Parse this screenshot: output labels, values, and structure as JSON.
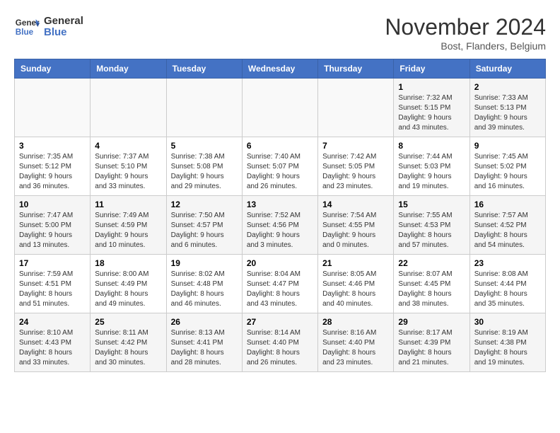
{
  "header": {
    "logo_line1": "General",
    "logo_line2": "Blue",
    "month_title": "November 2024",
    "subtitle": "Bost, Flanders, Belgium"
  },
  "weekdays": [
    "Sunday",
    "Monday",
    "Tuesday",
    "Wednesday",
    "Thursday",
    "Friday",
    "Saturday"
  ],
  "weeks": [
    [
      {
        "day": "",
        "info": ""
      },
      {
        "day": "",
        "info": ""
      },
      {
        "day": "",
        "info": ""
      },
      {
        "day": "",
        "info": ""
      },
      {
        "day": "",
        "info": ""
      },
      {
        "day": "1",
        "info": "Sunrise: 7:32 AM\nSunset: 5:15 PM\nDaylight: 9 hours and 43 minutes."
      },
      {
        "day": "2",
        "info": "Sunrise: 7:33 AM\nSunset: 5:13 PM\nDaylight: 9 hours and 39 minutes."
      }
    ],
    [
      {
        "day": "3",
        "info": "Sunrise: 7:35 AM\nSunset: 5:12 PM\nDaylight: 9 hours and 36 minutes."
      },
      {
        "day": "4",
        "info": "Sunrise: 7:37 AM\nSunset: 5:10 PM\nDaylight: 9 hours and 33 minutes."
      },
      {
        "day": "5",
        "info": "Sunrise: 7:38 AM\nSunset: 5:08 PM\nDaylight: 9 hours and 29 minutes."
      },
      {
        "day": "6",
        "info": "Sunrise: 7:40 AM\nSunset: 5:07 PM\nDaylight: 9 hours and 26 minutes."
      },
      {
        "day": "7",
        "info": "Sunrise: 7:42 AM\nSunset: 5:05 PM\nDaylight: 9 hours and 23 minutes."
      },
      {
        "day": "8",
        "info": "Sunrise: 7:44 AM\nSunset: 5:03 PM\nDaylight: 9 hours and 19 minutes."
      },
      {
        "day": "9",
        "info": "Sunrise: 7:45 AM\nSunset: 5:02 PM\nDaylight: 9 hours and 16 minutes."
      }
    ],
    [
      {
        "day": "10",
        "info": "Sunrise: 7:47 AM\nSunset: 5:00 PM\nDaylight: 9 hours and 13 minutes."
      },
      {
        "day": "11",
        "info": "Sunrise: 7:49 AM\nSunset: 4:59 PM\nDaylight: 9 hours and 10 minutes."
      },
      {
        "day": "12",
        "info": "Sunrise: 7:50 AM\nSunset: 4:57 PM\nDaylight: 9 hours and 6 minutes."
      },
      {
        "day": "13",
        "info": "Sunrise: 7:52 AM\nSunset: 4:56 PM\nDaylight: 9 hours and 3 minutes."
      },
      {
        "day": "14",
        "info": "Sunrise: 7:54 AM\nSunset: 4:55 PM\nDaylight: 9 hours and 0 minutes."
      },
      {
        "day": "15",
        "info": "Sunrise: 7:55 AM\nSunset: 4:53 PM\nDaylight: 8 hours and 57 minutes."
      },
      {
        "day": "16",
        "info": "Sunrise: 7:57 AM\nSunset: 4:52 PM\nDaylight: 8 hours and 54 minutes."
      }
    ],
    [
      {
        "day": "17",
        "info": "Sunrise: 7:59 AM\nSunset: 4:51 PM\nDaylight: 8 hours and 51 minutes."
      },
      {
        "day": "18",
        "info": "Sunrise: 8:00 AM\nSunset: 4:49 PM\nDaylight: 8 hours and 49 minutes."
      },
      {
        "day": "19",
        "info": "Sunrise: 8:02 AM\nSunset: 4:48 PM\nDaylight: 8 hours and 46 minutes."
      },
      {
        "day": "20",
        "info": "Sunrise: 8:04 AM\nSunset: 4:47 PM\nDaylight: 8 hours and 43 minutes."
      },
      {
        "day": "21",
        "info": "Sunrise: 8:05 AM\nSunset: 4:46 PM\nDaylight: 8 hours and 40 minutes."
      },
      {
        "day": "22",
        "info": "Sunrise: 8:07 AM\nSunset: 4:45 PM\nDaylight: 8 hours and 38 minutes."
      },
      {
        "day": "23",
        "info": "Sunrise: 8:08 AM\nSunset: 4:44 PM\nDaylight: 8 hours and 35 minutes."
      }
    ],
    [
      {
        "day": "24",
        "info": "Sunrise: 8:10 AM\nSunset: 4:43 PM\nDaylight: 8 hours and 33 minutes."
      },
      {
        "day": "25",
        "info": "Sunrise: 8:11 AM\nSunset: 4:42 PM\nDaylight: 8 hours and 30 minutes."
      },
      {
        "day": "26",
        "info": "Sunrise: 8:13 AM\nSunset: 4:41 PM\nDaylight: 8 hours and 28 minutes."
      },
      {
        "day": "27",
        "info": "Sunrise: 8:14 AM\nSunset: 4:40 PM\nDaylight: 8 hours and 26 minutes."
      },
      {
        "day": "28",
        "info": "Sunrise: 8:16 AM\nSunset: 4:40 PM\nDaylight: 8 hours and 23 minutes."
      },
      {
        "day": "29",
        "info": "Sunrise: 8:17 AM\nSunset: 4:39 PM\nDaylight: 8 hours and 21 minutes."
      },
      {
        "day": "30",
        "info": "Sunrise: 8:19 AM\nSunset: 4:38 PM\nDaylight: 8 hours and 19 minutes."
      }
    ]
  ]
}
